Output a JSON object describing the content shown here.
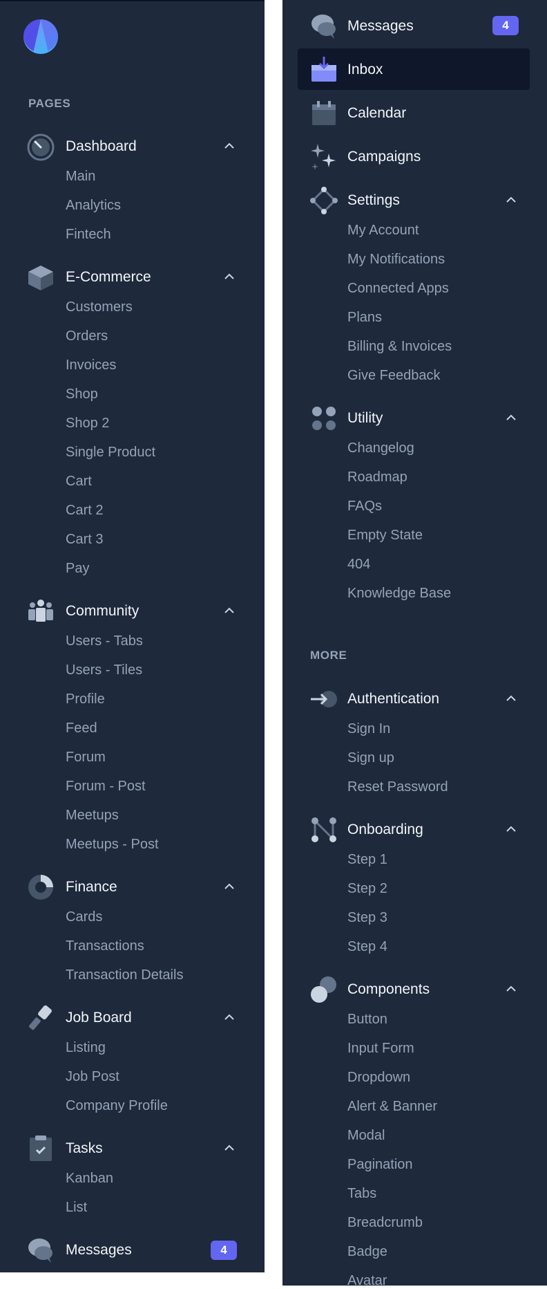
{
  "sections": {
    "pages": "PAGES",
    "more": "MORE"
  },
  "nav": {
    "dashboard": {
      "label": "Dashboard",
      "items": [
        "Main",
        "Analytics",
        "Fintech"
      ]
    },
    "ecommerce": {
      "label": "E-Commerce",
      "items": [
        "Customers",
        "Orders",
        "Invoices",
        "Shop",
        "Shop 2",
        "Single Product",
        "Cart",
        "Cart 2",
        "Cart 3",
        "Pay"
      ]
    },
    "community": {
      "label": "Community",
      "items": [
        "Users - Tabs",
        "Users - Tiles",
        "Profile",
        "Feed",
        "Forum",
        "Forum - Post",
        "Meetups",
        "Meetups - Post"
      ]
    },
    "finance": {
      "label": "Finance",
      "items": [
        "Cards",
        "Transactions",
        "Transaction Details"
      ]
    },
    "jobboard": {
      "label": "Job Board",
      "items": [
        "Listing",
        "Job Post",
        "Company Profile"
      ]
    },
    "tasks": {
      "label": "Tasks",
      "items": [
        "Kanban",
        "List"
      ]
    },
    "messages": {
      "label": "Messages",
      "badge": "4"
    },
    "inbox": {
      "label": "Inbox"
    },
    "calendar": {
      "label": "Calendar"
    },
    "campaigns": {
      "label": "Campaigns"
    },
    "settings": {
      "label": "Settings",
      "items": [
        "My Account",
        "My Notifications",
        "Connected Apps",
        "Plans",
        "Billing & Invoices",
        "Give Feedback"
      ]
    },
    "utility": {
      "label": "Utility",
      "items": [
        "Changelog",
        "Roadmap",
        "FAQs",
        "Empty State",
        "404",
        "Knowledge Base"
      ]
    },
    "authentication": {
      "label": "Authentication",
      "items": [
        "Sign In",
        "Sign up",
        "Reset Password"
      ]
    },
    "onboarding": {
      "label": "Onboarding",
      "items": [
        "Step 1",
        "Step 2",
        "Step 3",
        "Step 4"
      ]
    },
    "components": {
      "label": "Components",
      "items": [
        "Button",
        "Input Form",
        "Dropdown",
        "Alert & Banner",
        "Modal",
        "Pagination",
        "Tabs",
        "Breadcrumb",
        "Badge",
        "Avatar"
      ]
    }
  },
  "colors": {
    "sidebar_bg": "#1e293b",
    "active_bg": "#0f172a",
    "accent": "#6366f1",
    "muted": "#94a3b8",
    "text": "#f1f5f9"
  },
  "icons": {
    "logo": "app-logo-icon",
    "dashboard": "gauge-icon",
    "ecommerce": "box-icon",
    "community": "people-icon",
    "finance": "pie-chart-icon",
    "jobboard": "tool-icon",
    "tasks": "clipboard-icon",
    "messages": "chat-bubbles-icon",
    "inbox": "inbox-icon",
    "calendar": "calendar-icon",
    "campaigns": "sparkle-icon",
    "settings": "settings-nodes-icon",
    "utility": "grid-dots-icon",
    "authentication": "login-icon",
    "onboarding": "flow-icon",
    "components": "circles-icon"
  }
}
